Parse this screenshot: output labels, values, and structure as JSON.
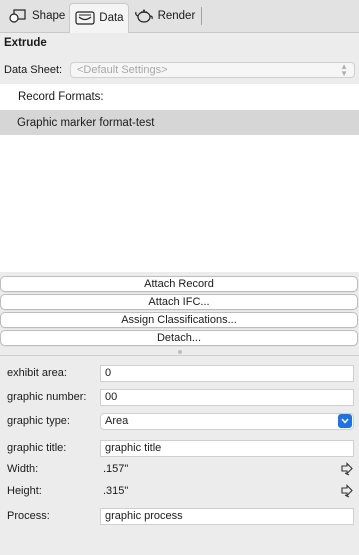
{
  "tabs": [
    {
      "label": "Shape",
      "icon": "shape-icon",
      "active": false
    },
    {
      "label": "Data",
      "icon": "data-icon",
      "active": true
    },
    {
      "label": "Render",
      "icon": "teapot-icon",
      "active": false
    }
  ],
  "section_title": "Extrude",
  "data_sheet": {
    "label": "Data Sheet:",
    "value": "<Default Settings>"
  },
  "records": {
    "header": "Record Formats:",
    "items": [
      "Graphic marker format-test"
    ]
  },
  "buttons": {
    "attach_record": "Attach Record",
    "attach_ifc": "Attach IFC...",
    "assign_classifications": "Assign Classifications...",
    "detach": "Detach..."
  },
  "fields": {
    "exhibit_area": {
      "label": "exhibit area:",
      "value": "0"
    },
    "graphic_number": {
      "label": "graphic number:",
      "value": "00"
    },
    "graphic_type": {
      "label": "graphic type:",
      "value": "Area"
    },
    "graphic_title": {
      "label": "graphic title:",
      "value": "graphic title"
    },
    "width": {
      "label": "Width:",
      "value": ".157\""
    },
    "height": {
      "label": "Height:",
      "value": ".315\""
    },
    "process": {
      "label": "Process:",
      "value": "graphic process"
    }
  },
  "colors": {
    "accent": "#1d72e6",
    "selection": "#d6d6d6"
  }
}
